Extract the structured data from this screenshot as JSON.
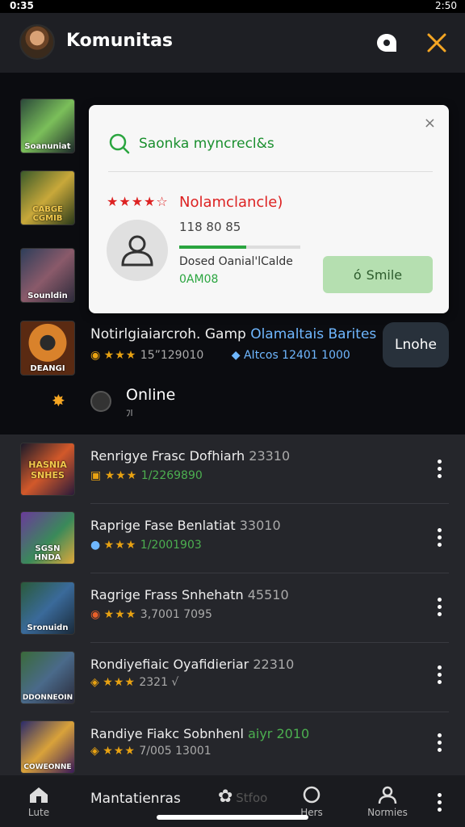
{
  "status_bar": {
    "left": "0:35",
    "right": "2:50"
  },
  "app_bar": {
    "title": "Komunitas"
  },
  "featured": [
    {
      "caption": "Soanuniat"
    },
    {
      "caption": "CABGE\nCGMIB"
    },
    {
      "caption": "Sounldin"
    },
    {
      "caption": "DEANGI"
    }
  ],
  "popup": {
    "search_text": "Saonka myncrecl&s",
    "stars": "★★★★☆",
    "name": "Nolamclancle)",
    "count": "1‘<sup>8</sup> 80 85",
    "count_plain": "118 80 85",
    "progress": 0.55,
    "desc": "Dosed Oanial'lCalde",
    "code": "0AM08",
    "button": "Smile",
    "close": "×"
  },
  "featured_row": {
    "title": "Notirlgiaiarcroh. Gamp",
    "title_link": "Olamaltais Barites",
    "stars": "★★★",
    "count": "15”129010",
    "meta_link": "AItcos 12401 1000",
    "unlock": "Lnohe"
  },
  "online": {
    "label": "Online",
    "sub": "ﾌl"
  },
  "list": [
    {
      "title": "Renrigye Frasc Dofhiarh",
      "num": "23310",
      "stars": "★★★",
      "meta": "1/2269890",
      "meta_color": "green",
      "caption": "HASNIA\nSNHES"
    },
    {
      "title": "Raprige Fase Benlatiat",
      "num": "33010",
      "stars": "★★★",
      "meta": "1/2001903",
      "meta_color": "green",
      "caption": "SGSN HNDA"
    },
    {
      "title": "Ragrige Frass Snhehatn",
      "num": "45510",
      "stars": "★★★",
      "meta": "3,7001 7095",
      "meta_color": "gray",
      "caption": "Sronuidn"
    },
    {
      "title": "Rondiyefiaic Oyafidieriar",
      "num": "22310",
      "stars": "★★★",
      "meta": "2321 √",
      "meta_color": "gray",
      "caption": "DDONNEOIN"
    },
    {
      "title": "Randiye Fiakc Sobnhenl",
      "num": "aiyr 2010",
      "stars": "★★★",
      "meta": "7/005 13001",
      "meta_color": "gray",
      "caption": "COWEONNE"
    }
  ],
  "bottom_nav": {
    "home": "Lute",
    "main": "Mantatienras",
    "gallery": "Stfoo",
    "chat": "Hers",
    "profile": "Normies"
  },
  "colors": {
    "accent_green": "#2aa53f",
    "star_gold": "#e8a212",
    "star_red": "#dd2222"
  }
}
